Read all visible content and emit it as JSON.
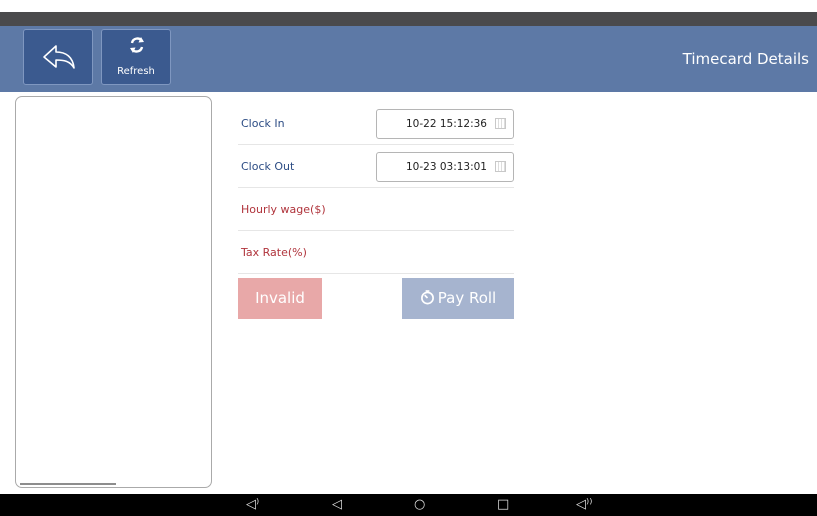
{
  "header": {
    "back_icon": "back-arrow-icon",
    "refresh_icon": "refresh-icon",
    "refresh_label": "Refresh",
    "title": "Timecard Details",
    "color": "#5d79a6"
  },
  "form": {
    "clock_in_label": "Clock In",
    "clock_in_value": "10-22 15:12:36",
    "clock_out_label": "Clock Out",
    "clock_out_value": "10-23 03:13:01",
    "hourly_wage_label": "Hourly wage($)",
    "tax_rate_label": "Tax Rate(%)",
    "calendar_icon": "calendar-icon"
  },
  "actions": {
    "invalid_label": "Invalid",
    "payroll_label": "Pay Roll",
    "payroll_icon": "timer-icon"
  },
  "navbar": {
    "icons": [
      "volume-down-icon",
      "back-icon",
      "home-icon",
      "recents-icon",
      "volume-up-icon"
    ]
  }
}
